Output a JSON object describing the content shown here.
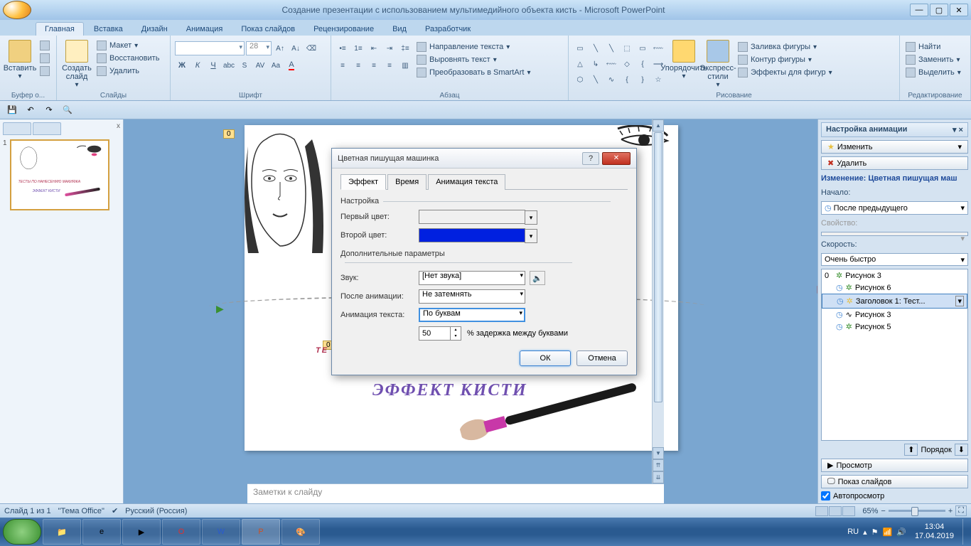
{
  "title": "Создание презентации с использованием мультимедийного объекта кисть - Microsoft PowerPoint",
  "ribbon_tabs": [
    "Главная",
    "Вставка",
    "Дизайн",
    "Анимация",
    "Показ слайдов",
    "Рецензирование",
    "Вид",
    "Разработчик"
  ],
  "ribbon": {
    "clipboard": {
      "label": "Буфер о...",
      "paste": "Вставить"
    },
    "slides": {
      "label": "Слайды",
      "new": "Создать\nслайд",
      "layout": "Макет",
      "reset": "Восстановить",
      "delete": "Удалить"
    },
    "font": {
      "label": "Шрифт",
      "size": "28"
    },
    "paragraph": {
      "label": "Абзац",
      "direction": "Направление текста",
      "align": "Выровнять текст",
      "smartart": "Преобразовать в SmartArt"
    },
    "drawing": {
      "label": "Рисование",
      "arrange": "Упорядочить",
      "styles": "Экспресс-стили",
      "fill": "Заливка фигуры",
      "outline": "Контур фигуры",
      "effects": "Эффекты для фигур"
    },
    "editing": {
      "label": "Редактирование",
      "find": "Найти",
      "replace": "Заменить",
      "select": "Выделить"
    }
  },
  "thumb": {
    "num": "1"
  },
  "slide": {
    "text1": "ТЕ",
    "text1b": "А",
    "text2": "ЭФФЕКТ КИСТИ",
    "marker0a": "0",
    "marker0b": "0",
    "marker0c": "0"
  },
  "notes_placeholder": "Заметки к слайду",
  "anim": {
    "title": "Настройка анимации",
    "change": "Изменить",
    "delete": "Удалить",
    "modify_label": "Изменение: Цветная пишущая маш",
    "start_label": "Начало:",
    "start_value": "После предыдущего",
    "property_label": "Свойство:",
    "speed_label": "Скорость:",
    "speed_value": "Очень быстро",
    "items": [
      {
        "num": "0",
        "name": "Рисунок 3"
      },
      {
        "num": "",
        "name": "Рисунок 6"
      },
      {
        "num": "",
        "name": "Заголовок 1: Тест..."
      },
      {
        "num": "",
        "name": "Рисунок 3"
      },
      {
        "num": "",
        "name": "Рисунок 5"
      }
    ],
    "order": "Порядок",
    "preview": "Просмотр",
    "slideshow": "Показ слайдов",
    "autopreview": "Автопросмотр"
  },
  "status": {
    "slide": "Слайд 1 из 1",
    "theme": "\"Тема Office\"",
    "lang": "Русский (Россия)",
    "zoom": "65%"
  },
  "taskbar": {
    "lang": "RU",
    "time": "13:04",
    "date": "17.04.2019"
  },
  "dialog": {
    "title": "Цветная пишущая машинка",
    "tabs": [
      "Эффект",
      "Время",
      "Анимация текста"
    ],
    "settings_group": "Настройка",
    "color1_label": "Первый цвет:",
    "color2_label": "Второй цвет:",
    "extra_group": "Дополнительные параметры",
    "sound_label": "Звук:",
    "sound_value": "[Нет звука]",
    "after_label": "После анимации:",
    "after_value": "Не затемнять",
    "textanim_label": "Анимация текста:",
    "textanim_value": "По буквам",
    "delay_value": "50",
    "delay_suffix": "% задержка между буквами",
    "ok": "ОК",
    "cancel": "Отмена",
    "color1": "#8b4a4a",
    "color2": "#0020e0"
  }
}
